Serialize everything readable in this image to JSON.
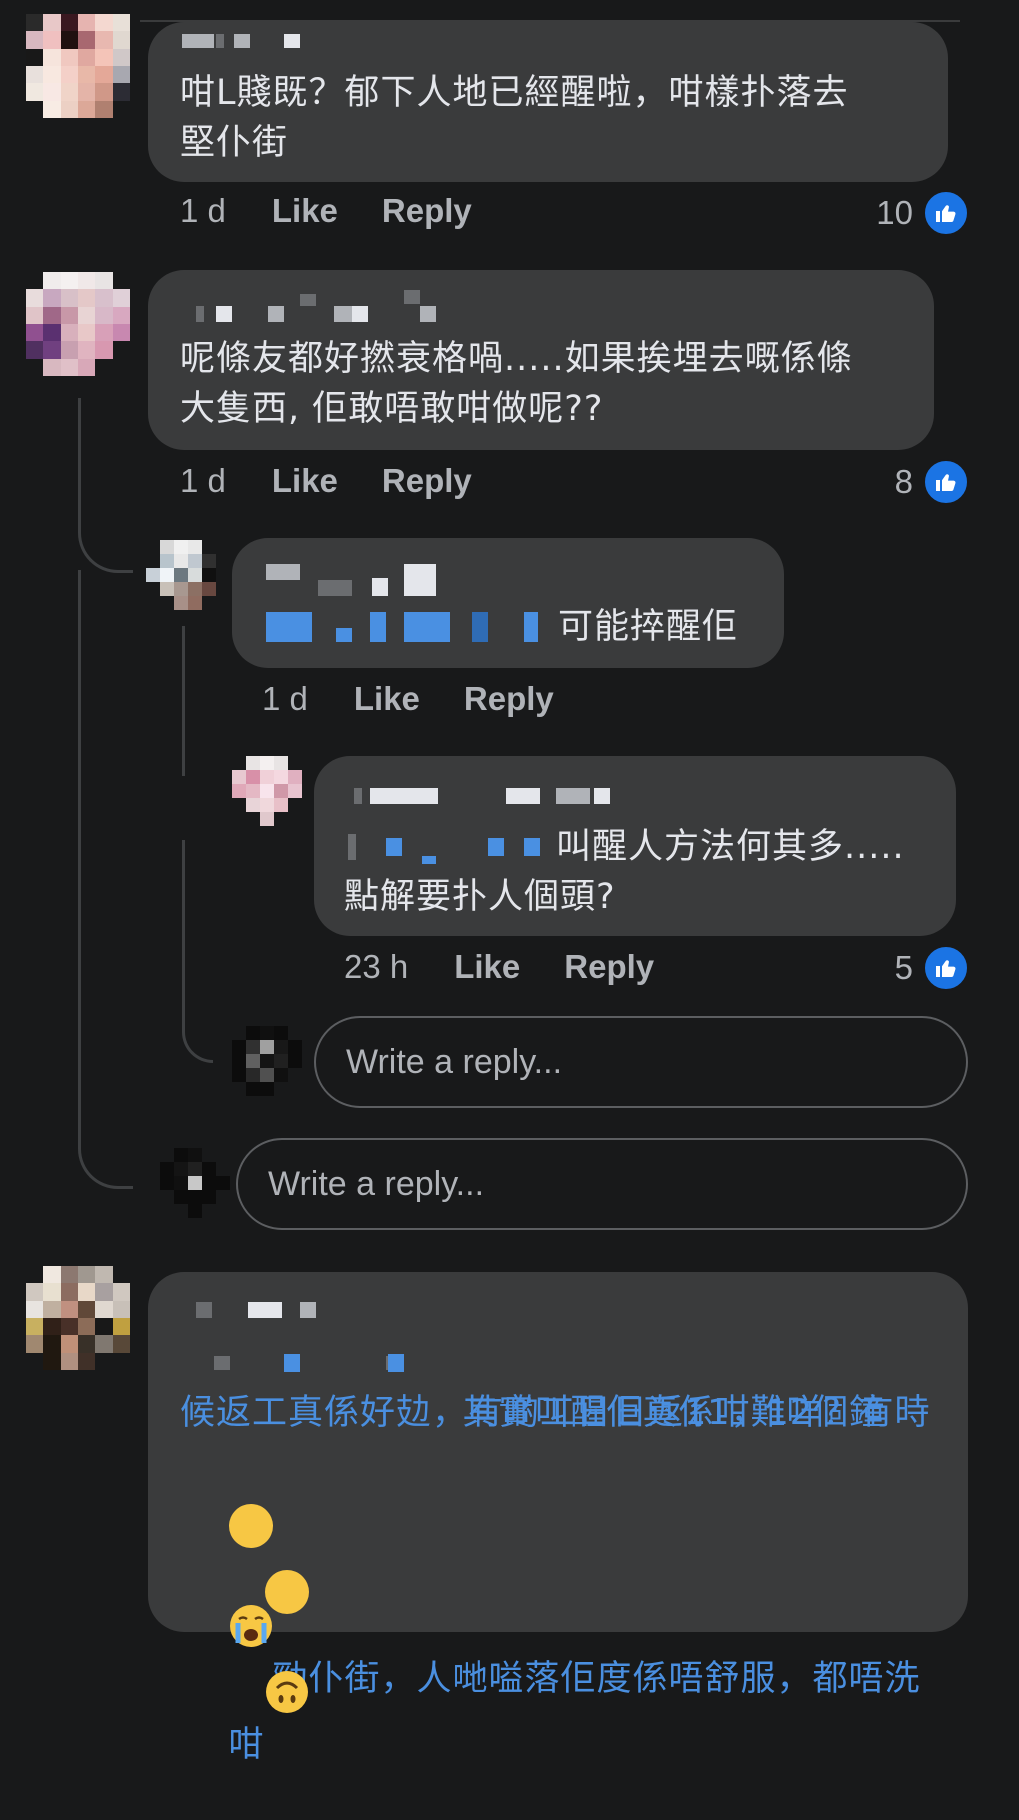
{
  "comments": [
    {
      "text": "咁L賤既？郁下人地已經醒啦，咁樣扑落去\n堅仆街",
      "time": "1 d",
      "like_label": "Like",
      "reply_label": "Reply",
      "like_count": "10"
    },
    {
      "text": "呢條友都好撚衰格喎.....如果挨埋去嘅係條\n大隻西, 佢敢唔敢咁做呢??",
      "time": "1 d",
      "like_label": "Like",
      "reply_label": "Reply",
      "like_count": "8",
      "replies": [
        {
          "text": "可能捽醒佢",
          "time": "1 d",
          "like_label": "Like",
          "reply_label": "Reply"
        },
        {
          "text_line1": "叫醒人方法何其多.....",
          "text_line2": "點解要扑人個頭?",
          "time": "23 h",
          "like_label": "Like",
          "reply_label": "Reply",
          "like_count": "5"
        }
      ],
      "nested_reply_placeholder": "Write a reply...",
      "reply_placeholder": "Write a reply..."
    },
    {
      "text_line1": "其實叫醒佢真係咁難咩？有時",
      "text_line2": "候返工真係好攰，有啲工日日返11，12個鐘",
      "text_line3": "勁仆街，人哋嗌落佢度係唔舒服，都唔洗",
      "text_line4": "咁"
    }
  ],
  "icons": {
    "like": "thumbs-up-icon",
    "emoji_cry": "loudly-crying-face-icon",
    "emoji_upside": "upside-down-face-icon"
  },
  "colors": {
    "background": "#18191a",
    "bubble": "#3a3b3c",
    "like_badge": "#1b74e4",
    "mention": "#4a8fe0"
  }
}
